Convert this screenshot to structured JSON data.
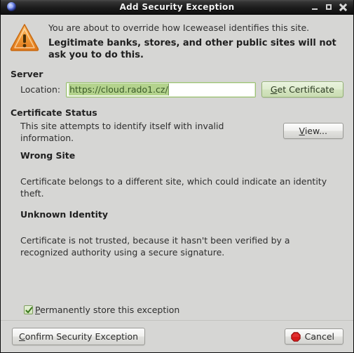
{
  "window": {
    "title": "Add Security Exception",
    "app_icon": "globe-icon",
    "controls": {
      "minimize": "minimize-icon",
      "maximize": "maximize-icon",
      "close": "close-icon"
    }
  },
  "warning": {
    "icon": "warning-triangle-icon",
    "line1": "You are about to override how Iceweasel identifies this site.",
    "line2": "Legitimate banks, stores, and other public sites will not ask you to do this."
  },
  "server": {
    "group_title": "Server",
    "location_label": "Location:",
    "location_value": "https://cloud.rado1.cz/",
    "location_placeholder": "",
    "get_certificate_button": {
      "mnemonic": "G",
      "rest": "et Certificate"
    }
  },
  "certificate_status": {
    "group_title": "Certificate Status",
    "summary": "This site attempts to identify itself with invalid information.",
    "view_button": {
      "mnemonic": "V",
      "rest": "iew..."
    },
    "issues": [
      {
        "heading": "Wrong Site",
        "detail": "Certificate belongs to a different site, which could indicate an identity theft."
      },
      {
        "heading": "Unknown Identity",
        "detail": "Certificate is not trusted, because it hasn't been verified by a recognized authority using a secure signature."
      }
    ]
  },
  "footer": {
    "checkbox": {
      "checked": true,
      "mnemonic": "P",
      "rest": "ermanently store this exception"
    },
    "confirm_button": {
      "mnemonic": "C",
      "rest": "onfirm Security Exception"
    },
    "cancel_button": {
      "icon": "stop-icon",
      "label": "Cancel"
    }
  },
  "colors": {
    "titlebar_dark": "#1c1c1c",
    "dialog_bg": "#d6d6d4",
    "accent_green": "#b4d38d",
    "warning_orange": "#f0922b",
    "cancel_red": "#d51b1b"
  }
}
